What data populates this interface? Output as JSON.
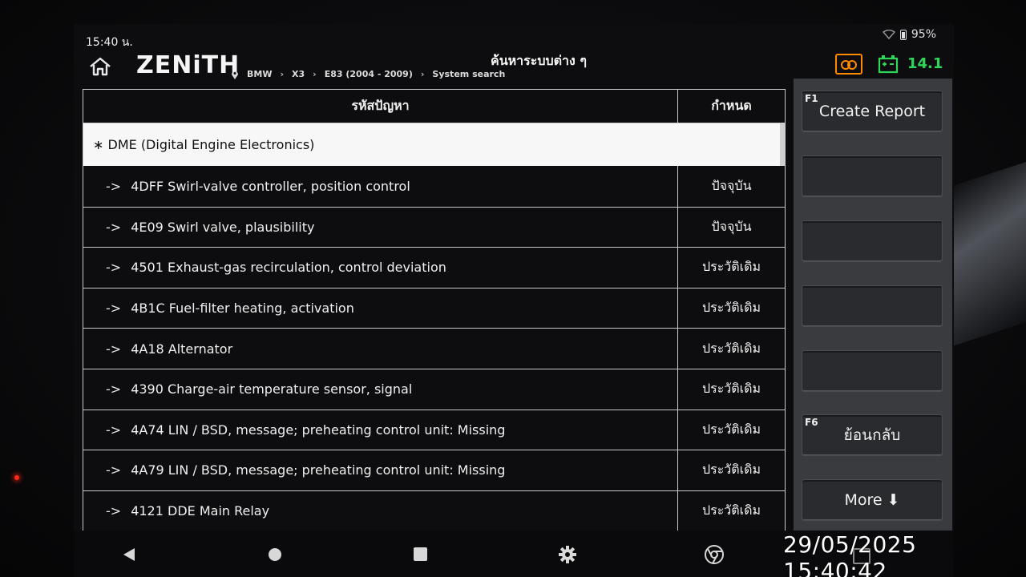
{
  "status_bar": {
    "time": "15:40 น.",
    "battery": "95%"
  },
  "header": {
    "logo": "ZENiTH",
    "title": "ค้นหาระบบต่าง ๆ",
    "breadcrumb": [
      "BMW",
      "X3",
      "E83 (2004 - 2009)",
      "System search"
    ],
    "voltage": "14.1"
  },
  "table": {
    "columns": [
      "รหัสปัญหา",
      "กำหนด"
    ],
    "group": "∗ DME (Digital Engine Electronics)",
    "rows": [
      {
        "code": "4DFF Swirl-valve controller, position control",
        "status": "ปัจจุบัน"
      },
      {
        "code": "4E09 Swirl valve, plausibility",
        "status": "ปัจจุบัน"
      },
      {
        "code": "4501 Exhaust-gas recirculation, control deviation",
        "status": "ประวัติเดิม"
      },
      {
        "code": "4B1C Fuel-filter heating, activation",
        "status": "ประวัติเดิม"
      },
      {
        "code": "4A18 Alternator",
        "status": "ประวัติเดิม"
      },
      {
        "code": "4390 Charge-air temperature sensor, signal",
        "status": "ประวัติเดิม"
      },
      {
        "code": "4A74 LIN / BSD, message; preheating control unit: Missing",
        "status": "ประวัติเดิม"
      },
      {
        "code": "4A79 LIN / BSD, message; preheating control unit: Missing",
        "status": "ประวัติเดิม"
      },
      {
        "code": "4121 DDE Main Relay",
        "status": "ประวัติเดิม"
      }
    ],
    "row_arrow": "->"
  },
  "side_panel": {
    "f1_key": "F1",
    "create_report": "Create Report",
    "f6_key": "F6",
    "back": "ย้อนกลับ",
    "more": "More ⬇"
  },
  "timestamp": "29/05/2025 15:40:42",
  "colors": {
    "voltage": "#2fd65a",
    "recorder": "#ff8a00",
    "panel": "#3a3b3e"
  }
}
